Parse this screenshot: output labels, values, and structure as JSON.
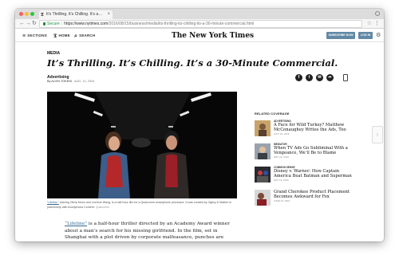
{
  "browser": {
    "tab_title": "It’s Thrilling. It’s Chilling. It’s a…",
    "secure_label": "Secure",
    "url_base": "https://www.nytimes.com",
    "url_path": "/2016/08/15/business/media/its-thrilling-its-chilling-its-a-30-minute-commercial.html"
  },
  "header": {
    "sections_label": "SECTIONS",
    "home_label": "HOME",
    "search_label": "SEARCH",
    "logo_text": "The New York Times",
    "subscribe_label": "SUBSCRIBE NOW",
    "login_label": "LOG IN"
  },
  "article": {
    "section": "MEDIA",
    "headline": "It’s Thrilling. It’s Chilling. It’s a 30-Minute Commercial.",
    "kicker": "Advertising",
    "byline": "By ALVIN TOKENI",
    "date": "AUG. 14, 2016",
    "caption_link": "“Lifeline,”",
    "caption_text": " starring Olivia Munn and Leehom Wang, is a half-hour film for a Qualcomm smartphone processor. It was created by Ogilvy & Mather in partnership with Anonymous Content.",
    "caption_credit": "Qualcomm",
    "body_link": "“Lifeline”",
    "body_text": " is a half-hour thriller directed by an Academy Award winner about a man’s search for his missing girlfriend. In the film, set in Shanghai with a plot driven by corporate malfeasance, punches are thrown, shots are"
  },
  "share": {
    "facebook": "f",
    "twitter": "t",
    "email": "✉",
    "more": "➦"
  },
  "related": {
    "title": "RELATED COVERAGE",
    "items": [
      {
        "kicker": "ADVERTISING",
        "title": "A Face for Wild Turkey? Matthew McConaughey Writes the Ads, Too",
        "date": "JULY 31, 2016"
      },
      {
        "kicker": "MEDIATOR",
        "title": "When TV Ads Go Subliminal With a Vengeance, We’ll Be to Blame",
        "date": "MAY 22, 2016"
      },
      {
        "kicker": "COMMON SENSE",
        "title": "Disney v. Warner: How Captain America Beat Batman and Superman",
        "date": "MAY 19, 2016"
      },
      {
        "kicker": "",
        "title": "Grand Cherokee Product Placement Becomes Awkward for Fox",
        "date": "JUNE 23, 2016"
      }
    ]
  },
  "colors": {
    "nyt_button": "#6288a5",
    "link": "#326891",
    "secure": "#1a8f3a"
  }
}
